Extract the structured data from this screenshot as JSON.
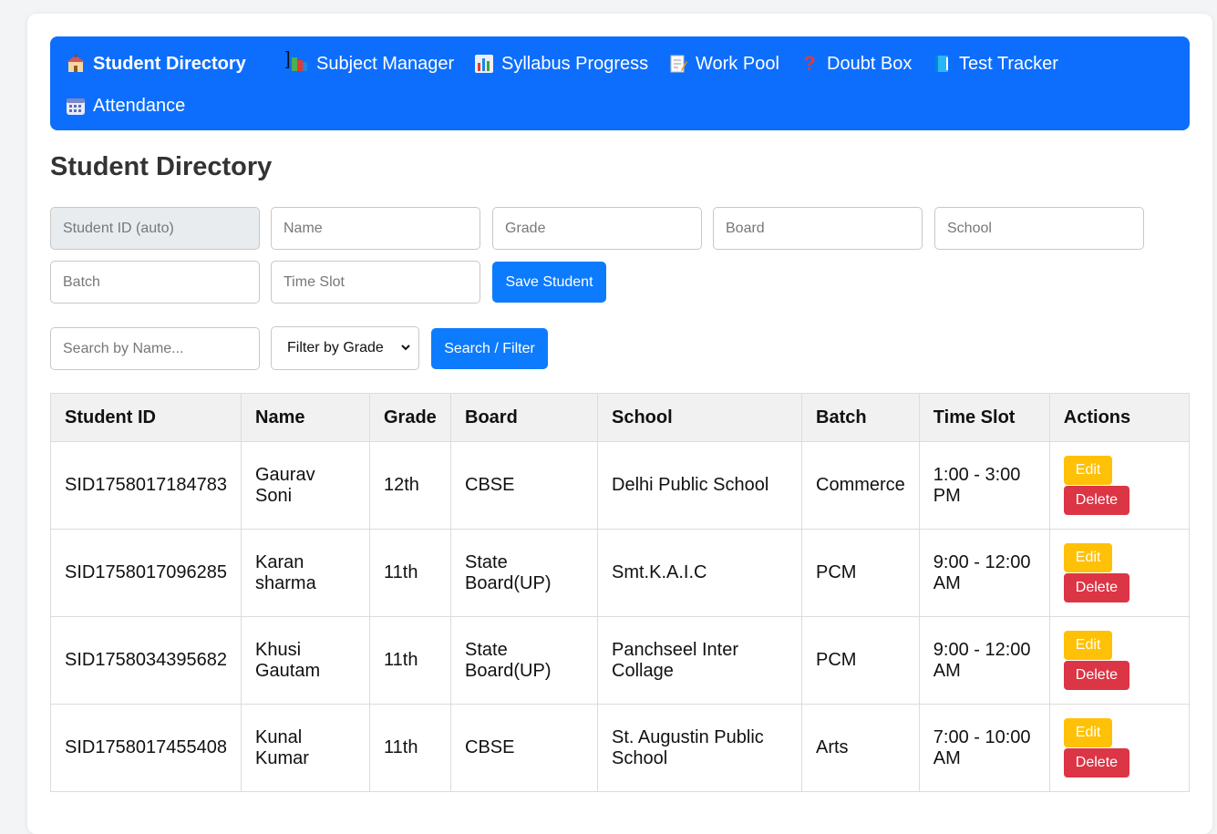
{
  "nav": {
    "items": [
      {
        "label": "Student Directory",
        "icon": "school-icon"
      },
      {
        "label": "Subject Manager",
        "icon": "books-icon"
      },
      {
        "label": "Syllabus Progress",
        "icon": "bar-chart-icon"
      },
      {
        "label": "Work Pool",
        "icon": "memo-icon"
      },
      {
        "label": "Doubt Box",
        "icon": "question-icon"
      },
      {
        "label": "Test Tracker",
        "icon": "book-icon"
      },
      {
        "label": "Attendance",
        "icon": "calendar-icon"
      }
    ],
    "separator": "]"
  },
  "page_title": "Student Directory",
  "form": {
    "student_id_placeholder": "Student ID (auto)",
    "name_placeholder": "Name",
    "grade_placeholder": "Grade",
    "board_placeholder": "Board",
    "school_placeholder": "School",
    "batch_placeholder": "Batch",
    "time_slot_placeholder": "Time Slot",
    "save_label": "Save Student"
  },
  "search": {
    "placeholder": "Search by Name...",
    "filter_selected": "Filter by Grade",
    "button_label": "Search / Filter"
  },
  "table": {
    "headers": [
      "Student ID",
      "Name",
      "Grade",
      "Board",
      "School",
      "Batch",
      "Time Slot",
      "Actions"
    ],
    "rows": [
      {
        "id": "SID1758017184783",
        "name": "Gaurav Soni",
        "grade": "12th",
        "board": "CBSE",
        "school": "Delhi Public School",
        "batch": "Commerce",
        "slot": "1:00 - 3:00 PM"
      },
      {
        "id": "SID1758017096285",
        "name": "Karan sharma",
        "grade": "11th",
        "board": "State Board(UP)",
        "school": "Smt.K.A.I.C",
        "batch": "PCM",
        "slot": "9:00 - 12:00 AM"
      },
      {
        "id": "SID1758034395682",
        "name": "Khusi Gautam",
        "grade": "11th",
        "board": "State Board(UP)",
        "school": "Panchseel Inter Collage",
        "batch": "PCM",
        "slot": "9:00 - 12:00 AM"
      },
      {
        "id": "SID1758017455408",
        "name": "Kunal Kumar",
        "grade": "11th",
        "board": "CBSE",
        "school": "St. Augustin Public School",
        "batch": "Arts",
        "slot": "7:00 - 10:00 AM"
      }
    ],
    "edit_label": "Edit",
    "delete_label": "Delete"
  },
  "colors": {
    "nav_bg": "#0d6efd",
    "primary": "#0d7bfd",
    "edit": "#ffc107",
    "delete": "#dc3545"
  }
}
